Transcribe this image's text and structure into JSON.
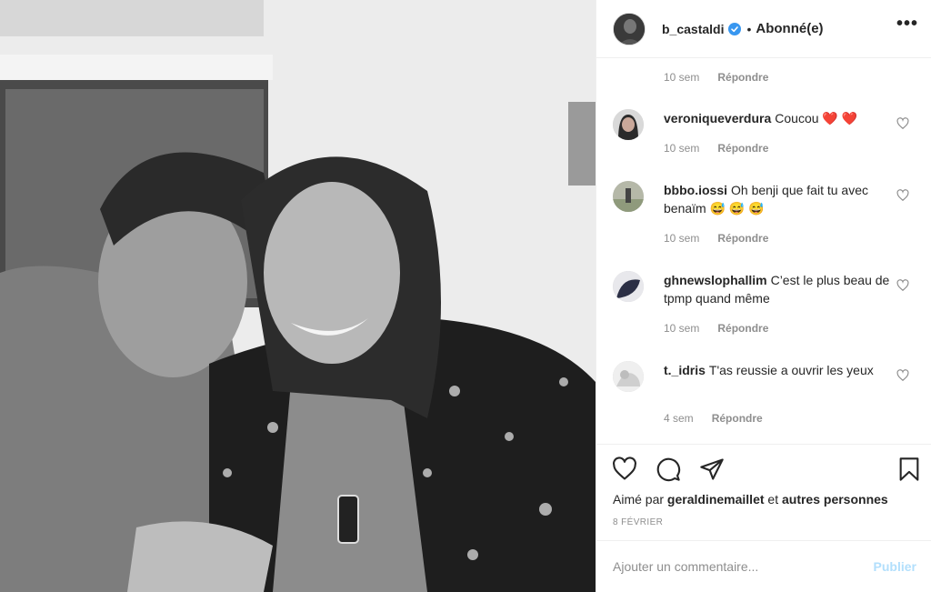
{
  "header": {
    "username": "b_castaldi",
    "separator": "•",
    "follow_label": "Abonné(e)",
    "more_label": "•••"
  },
  "comments": {
    "top_meta": {
      "time": "10 sem",
      "reply": "Répondre"
    },
    "items": [
      {
        "username": "veroniqueverdura",
        "text": "Coucou ❤️ ❤️",
        "time": "10 sem",
        "reply": "Répondre"
      },
      {
        "username": "bbbo.iossi",
        "text": "Oh benji que fait tu avec benaïm 😅 😅 😅",
        "time": "10 sem",
        "reply": "Répondre"
      },
      {
        "username": "ghnewslophallim",
        "text": "C’est le plus beau de tpmp quand même",
        "time": "10 sem",
        "reply": "Répondre"
      },
      {
        "username": "t._idris",
        "text": "T'as reussie a ouvrir les yeux",
        "time": "4 sem",
        "reply": "Répondre"
      }
    ]
  },
  "actions": {
    "likes_prefix": "Aimé par",
    "likes_user": "geraldinemaillet",
    "likes_mid": "et",
    "likes_others": "autres personnes",
    "date": "8 FÉVRIER"
  },
  "add_comment": {
    "placeholder": "Ajouter un commentaire...",
    "publish_label": "Publier"
  },
  "colors": {
    "verified": "#3897f0",
    "publish_disabled": "#b2dffc",
    "muted": "#8e8e8e"
  }
}
